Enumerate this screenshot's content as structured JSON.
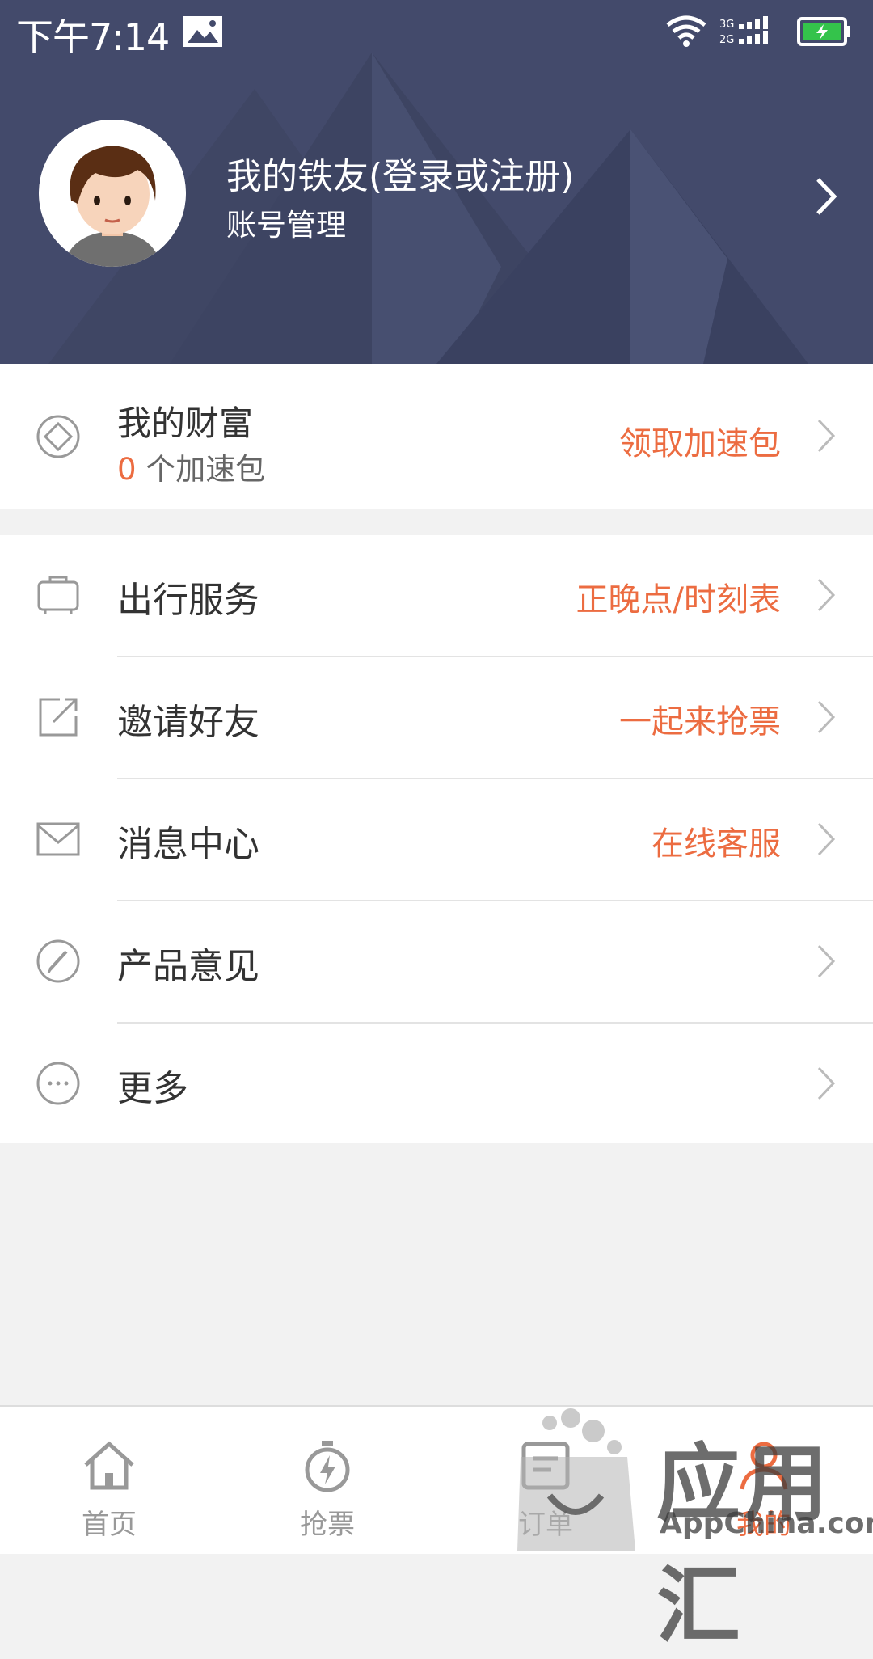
{
  "status_bar": {
    "time": "下午7:14",
    "network": "3G 2G",
    "icons": [
      "image-icon",
      "wifi-icon",
      "signal-icon",
      "battery-charging-icon"
    ]
  },
  "profile": {
    "name": "我的铁友(登录或注册)",
    "subtitle": "账号管理"
  },
  "wealth": {
    "title": "我的财富",
    "count": "0",
    "count_suffix": " 个加速包",
    "action": "领取加速包",
    "icon": "diamond-icon"
  },
  "menu": [
    {
      "label": "出行服务",
      "action": "正晚点/时刻表",
      "icon": "train-icon"
    },
    {
      "label": "邀请好友",
      "action": "一起来抢票",
      "icon": "share-icon"
    },
    {
      "label": "消息中心",
      "action": "在线客服",
      "icon": "mail-icon"
    },
    {
      "label": "产品意见",
      "action": "",
      "icon": "pencil-icon"
    },
    {
      "label": "更多",
      "action": "",
      "icon": "more-icon"
    }
  ],
  "tabs": [
    {
      "label": "首页",
      "icon": "home-icon",
      "active": false
    },
    {
      "label": "抢票",
      "icon": "stopwatch-icon",
      "active": false
    },
    {
      "label": "订单",
      "icon": "order-icon",
      "active": false
    },
    {
      "label": "我的",
      "icon": "user-icon",
      "active": true
    }
  ],
  "watermark": {
    "text": "应用汇",
    "sub": "AppChina.com"
  },
  "colors": {
    "header_bg": "#434a6b",
    "accent": "#ec6c41",
    "background": "#f2f2f2"
  }
}
